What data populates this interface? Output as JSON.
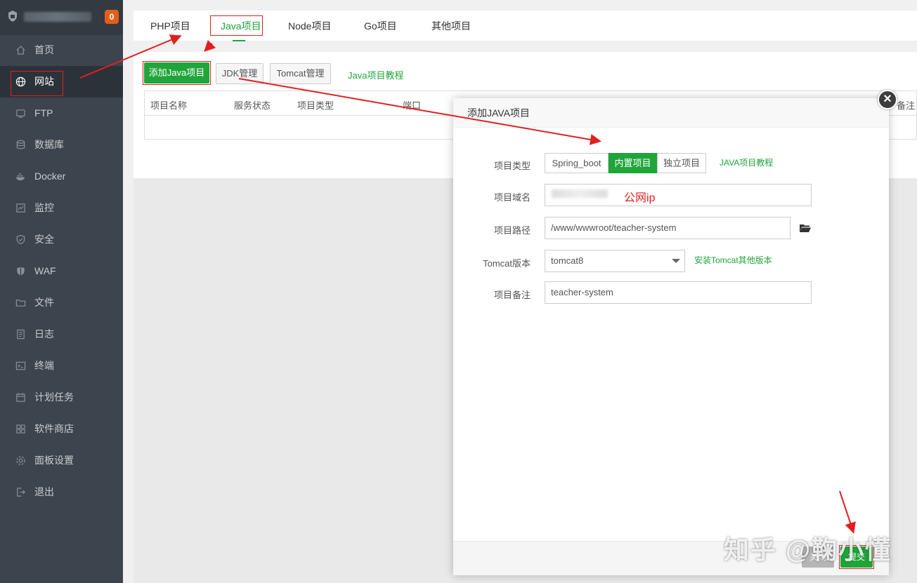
{
  "sidebar": {
    "badge": "0",
    "items": [
      {
        "label": "首页",
        "icon": "home-icon"
      },
      {
        "label": "网站",
        "icon": "globe-icon"
      },
      {
        "label": "FTP",
        "icon": "ftp-icon"
      },
      {
        "label": "数据库",
        "icon": "database-icon"
      },
      {
        "label": "Docker",
        "icon": "docker-icon"
      },
      {
        "label": "监控",
        "icon": "monitor-icon"
      },
      {
        "label": "安全",
        "icon": "shield-icon"
      },
      {
        "label": "WAF",
        "icon": "waf-icon"
      },
      {
        "label": "文件",
        "icon": "folder-icon"
      },
      {
        "label": "日志",
        "icon": "log-icon"
      },
      {
        "label": "终端",
        "icon": "terminal-icon"
      },
      {
        "label": "计划任务",
        "icon": "calendar-icon"
      },
      {
        "label": "软件商店",
        "icon": "apps-icon"
      },
      {
        "label": "面板设置",
        "icon": "gear-icon"
      },
      {
        "label": "退出",
        "icon": "logout-icon"
      }
    ],
    "active_index": 1
  },
  "tabs": [
    "PHP项目",
    "Java项目",
    "Node项目",
    "Go项目",
    "其他项目"
  ],
  "toolbar": {
    "add_java": "添加Java项目",
    "jdk": "JDK管理",
    "tomcat": "Tomcat管理",
    "tutorial": "Java项目教程"
  },
  "table": {
    "headers": [
      "项目名称",
      "服务状态",
      "项目类型",
      "端口",
      "备注"
    ]
  },
  "modal": {
    "title": "添加JAVA项目",
    "close_glyph": "×",
    "type_label": "项目类型",
    "type_options": [
      "Spring_boot",
      "内置项目",
      "独立项目"
    ],
    "type_selected": "内置项目",
    "tutorial_link": "JAVA项目教程",
    "domain_label": "项目域名",
    "domain_annotation": "公网ip",
    "path_label": "项目路径",
    "path_value": "/www/wwwroot/teacher-system",
    "tomcat_label": "Tomcat版本",
    "tomcat_value": "tomcat8",
    "install_tomcat": "安装Tomcat其他版本",
    "remark_label": "项目备注",
    "remark_value": "teacher-system",
    "close_button": "关闭",
    "submit_button": "提交"
  },
  "watermark": "知乎 @鞠小懂",
  "colors": {
    "accent": "#20a53a",
    "annotation": "#e02020",
    "sidebar": "#3c444d"
  }
}
